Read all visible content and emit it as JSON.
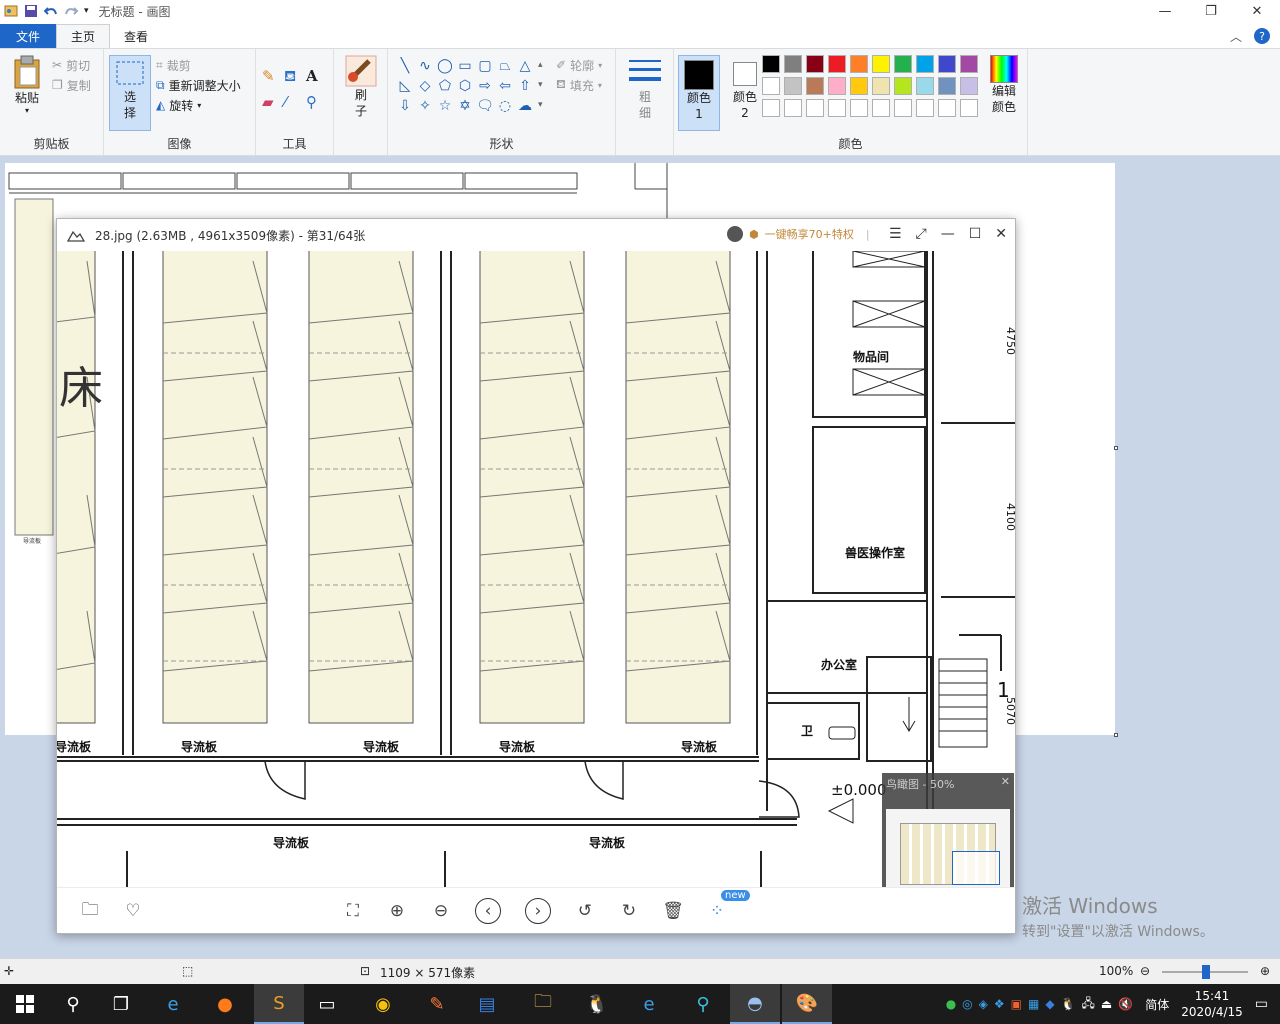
{
  "paint": {
    "title": "无标题 - 画图",
    "tabs": [
      "文件",
      "主页",
      "查看"
    ],
    "clipboard": {
      "paste": "粘贴",
      "cut": "剪切",
      "copy": "复制",
      "label": "剪贴板"
    },
    "image": {
      "select": "选择",
      "crop": "裁剪",
      "resize": "重新调整大小",
      "rotate": "旋转",
      "label": "图像"
    },
    "tools": {
      "label": "工具"
    },
    "brush": {
      "label": "刷子"
    },
    "shapes": {
      "outline": "轮廓",
      "fill": "填充",
      "label": "形状"
    },
    "size": {
      "label": "粗细"
    },
    "color1": "颜色 1",
    "color2": "颜色 2",
    "edit_colors": "编辑颜色",
    "colors_label": "颜色",
    "palette": [
      "#000000",
      "#7f7f7f",
      "#880015",
      "#ed1c24",
      "#ff7f27",
      "#fff200",
      "#22b14c",
      "#00a2e8",
      "#3f48cc",
      "#a349a4",
      "#ffffff",
      "#c3c3c3",
      "#b97a57",
      "#ffaec9",
      "#ffc90e",
      "#efe4b0",
      "#b5e61d",
      "#99d9ea",
      "#7092be",
      "#c8bfe7",
      "#ffffff",
      "#ffffff",
      "#ffffff",
      "#ffffff",
      "#ffffff",
      "#ffffff",
      "#ffffff",
      "#ffffff",
      "#ffffff",
      "#ffffff"
    ],
    "status": {
      "dimensions": "1109 × 571像素",
      "zoom": "100%"
    }
  },
  "viewer": {
    "title": "28.jpg (2.63MB , 4961x3509像素) - 第31/64张",
    "promo": "一键畅享70+特权",
    "thumbnail_label": "鸟瞰图 - 50%",
    "new_badge": "new"
  },
  "drawing": {
    "rooms": [
      "物品间",
      "兽医操作室",
      "办公室",
      "卫",
      "±0.000"
    ],
    "plates": [
      "导流板",
      "导流板",
      "导流板",
      "导流板",
      "导流板",
      "导流板",
      "导流板"
    ],
    "char_fragment": "床",
    "dims": [
      "4750",
      "4100",
      "5070",
      "1"
    ]
  },
  "watermark": {
    "line1": "激活 Windows",
    "line2": "转到\"设置\"以激活 Windows。"
  },
  "taskbar": {
    "time": "15:41",
    "date": "2020/4/15",
    "ime": "简体"
  }
}
